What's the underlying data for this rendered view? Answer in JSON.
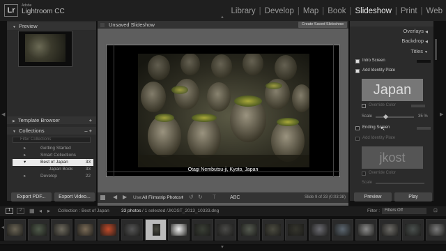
{
  "app": {
    "brand_small": "Adobe",
    "brand_name": "Lightroom CC",
    "logo": "Lr"
  },
  "modules": [
    "Library",
    "Develop",
    "Map",
    "Book",
    "Slideshow",
    "Print",
    "Web"
  ],
  "active_module": "Slideshow",
  "left_panel": {
    "preview_label": "Preview",
    "template_browser_label": "Template Browser",
    "collections_label": "Collections",
    "filter_placeholder": "Filter Collections",
    "collections": [
      {
        "label": "Getting Started",
        "count": ""
      },
      {
        "label": "Smart Collections",
        "count": ""
      },
      {
        "label": "Best of Japan",
        "count": "33",
        "selected": true
      },
      {
        "label": "Japan Book",
        "count": "33"
      },
      {
        "label": "Develop",
        "count": "22"
      }
    ],
    "export_pdf": "Export PDF...",
    "export_video": "Export Video..."
  },
  "center": {
    "title": "Unsaved Slideshow",
    "create_saved": "Create Saved Slideshow",
    "caption": "Otagi Nembutsu-ji, Kyoto,  Japan",
    "use_label": "Use:",
    "use_value": "All Filmstrip Photos",
    "abc": "ABC",
    "slide_info": "Slide 9 of 33 (0:03:38)"
  },
  "right_panel": {
    "overlays": "Overlays",
    "backdrop": "Backdrop",
    "titles": "Titles",
    "intro_screen": "Intro Screen",
    "add_identity_plate": "Add Identity Plate",
    "identity_text": "Japan",
    "override_color": "Override Color",
    "scale_label": "Scale",
    "scale_value": "35",
    "scale_unit": "%",
    "ending_screen": "Ending Screen",
    "add_identity_plate2": "Add Identity Plate",
    "identity_text2": "jkost",
    "override_color2": "Override Color",
    "scale_label2": "Scale",
    "preview_btn": "Preview",
    "play_btn": "Play"
  },
  "filmstrip": {
    "page1": "1",
    "page2": "2",
    "path_text": "Collection : Best of Japan",
    "count_text": "33 photos",
    "selected_text": "/ 1 selected /JKOST_2013_10333.dng",
    "filter_label": "Filter :",
    "filter_value": "Filters Off"
  },
  "colors": {
    "accent_selected": "#eaeaea",
    "background": "#111111"
  }
}
